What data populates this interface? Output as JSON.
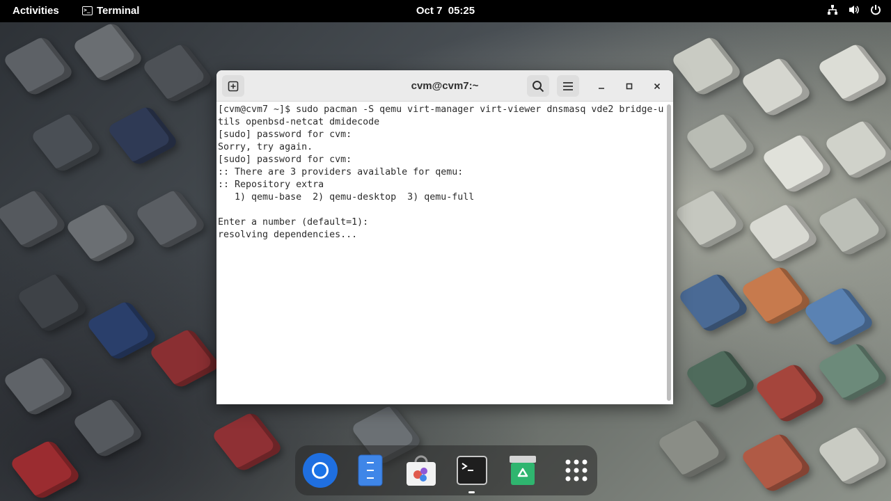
{
  "topbar": {
    "activities": "Activities",
    "app_name": "Terminal",
    "clock": "Oct 7  05:25",
    "tray_icons": [
      "network-icon",
      "volume-icon",
      "power-icon"
    ]
  },
  "window": {
    "title": "cvm@cvm7:~",
    "lines": [
      "[cvm@cvm7 ~]$ sudo pacman -S qemu virt-manager virt-viewer dnsmasq vde2 bridge-u",
      "tils openbsd-netcat dmidecode",
      "[sudo] password for cvm:",
      "Sorry, try again.",
      "[sudo] password for cvm:",
      ":: There are 3 providers available for qemu:",
      ":: Repository extra",
      "   1) qemu-base  2) qemu-desktop  3) qemu-full",
      "",
      "Enter a number (default=1):",
      "resolving dependencies..."
    ]
  },
  "dock": {
    "items": [
      "chrome-icon",
      "files-icon",
      "software-icon",
      "terminal-icon",
      "trash-icon",
      "app-grid-icon"
    ]
  },
  "colors": {
    "topbar_bg": "#000000",
    "headerbar_bg": "#ebebeb",
    "terminal_bg": "#ffffff",
    "terminal_fg": "#2b2b2b"
  }
}
